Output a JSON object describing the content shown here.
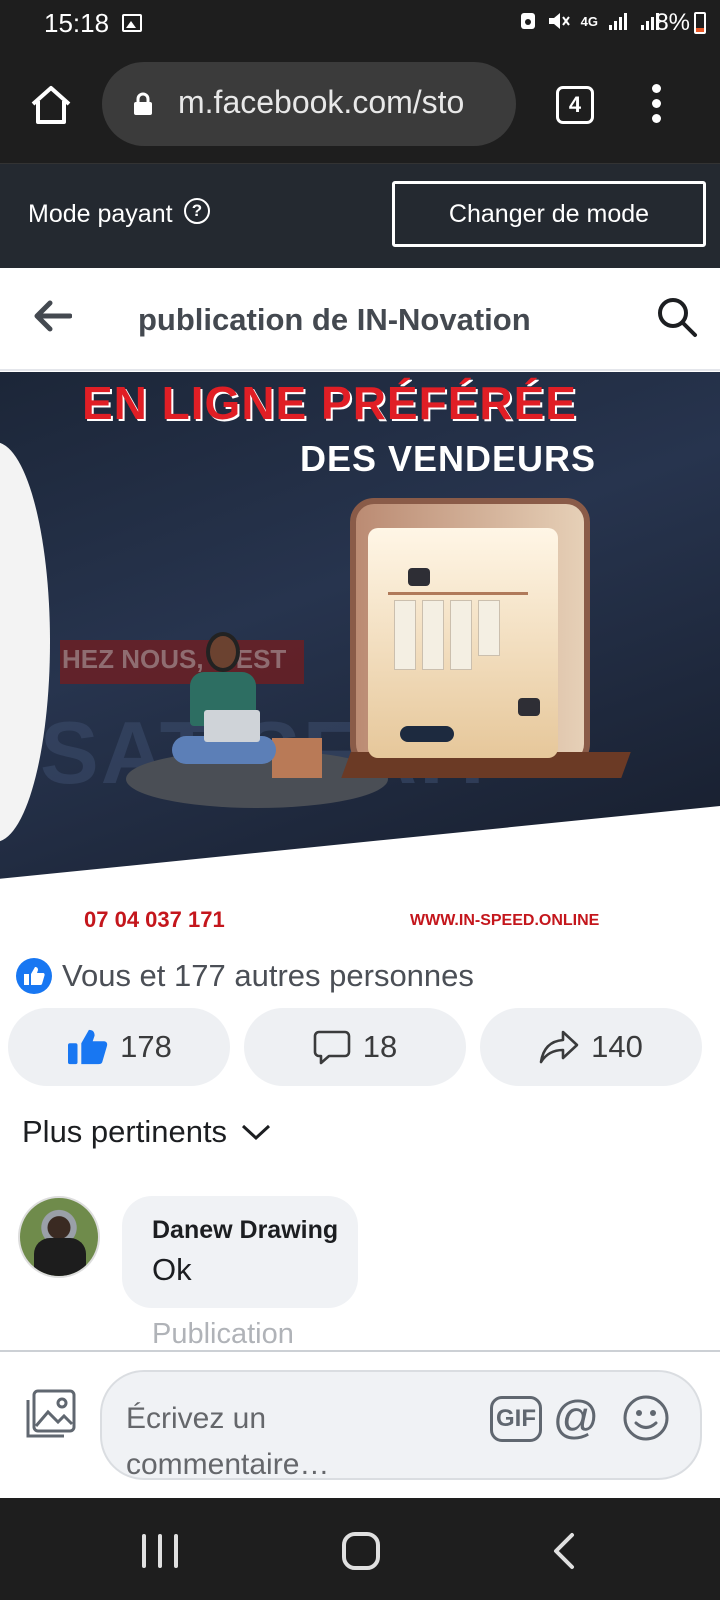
{
  "status_bar": {
    "time": "15:18",
    "network": "4G",
    "battery": "8%",
    "icons": [
      "gallery-icon",
      "recycle-icon",
      "mute-icon",
      "signal-icon",
      "signal-icon",
      "battery-icon"
    ]
  },
  "browser": {
    "url": "m.facebook.com/sto",
    "tab_count": "4"
  },
  "mode_bar": {
    "label": "Mode payant",
    "button": "Changer de mode"
  },
  "header": {
    "title": "publication de IN-Novation"
  },
  "post": {
    "image_headline_1": "EN LIGNE PRÉFÉRÉE",
    "image_headline_2": "DES VENDEURS",
    "image_phone": "07 04 037 171",
    "image_website": "WWW.IN-SPEED.ONLINE",
    "image_bg_text": "HEZ NOUS, C'EST",
    "image_bg_big": "SATISFAIT"
  },
  "reactions": {
    "summary": "Vous et 177 autres personnes",
    "likes": "178",
    "comments": "18",
    "shares": "140"
  },
  "comments_section": {
    "sort_label": "Plus pertinents",
    "items": [
      {
        "author": "Danew Drawing",
        "text": "Ok",
        "sub": "Publication"
      }
    ]
  },
  "composer": {
    "placeholder": "Écrivez un commentaire…",
    "gif_label": "GIF",
    "mention_label": "@"
  },
  "colors": {
    "facebook_blue": "#1877f2",
    "headline_red": "#e01e25",
    "dark_bar": "#1e1e1e"
  }
}
